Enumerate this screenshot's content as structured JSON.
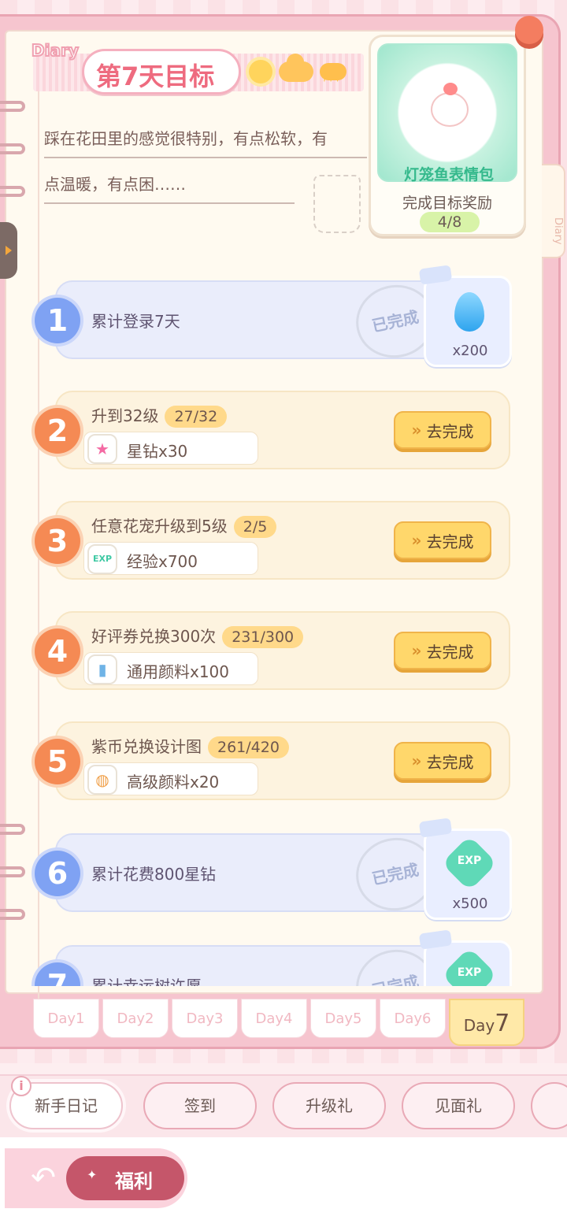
{
  "header": {
    "diary_label": "Diary",
    "title": "第7天目标",
    "story_line1": "踩在花田里的感觉很特别，有点松软，有",
    "story_line2": "点温暖，有点困……"
  },
  "reward": {
    "name": "灯笼鱼表情包",
    "caption": "完成目标奖励",
    "progress": "4/8"
  },
  "right_tab_label": "Diary",
  "tasks": [
    {
      "num": "1",
      "title": "累计登录7天",
      "state": "done",
      "stamp": "已完成",
      "reward_icon": "water-drop-icon",
      "reward_qty": "x200"
    },
    {
      "num": "2",
      "title": "升到32级",
      "progress": "27/32",
      "state": "todo",
      "item_icon": "star-diamond-icon",
      "item_name": "星钻x30",
      "button": "去完成"
    },
    {
      "num": "3",
      "title": "任意花宠升级到5级",
      "progress": "2/5",
      "state": "todo",
      "item_icon": "exp-icon",
      "item_name": "经验x700",
      "button": "去完成"
    },
    {
      "num": "4",
      "title": "好评券兑换300次",
      "progress": "231/300",
      "state": "todo",
      "item_icon": "paint-bottle-icon",
      "item_name": "通用颜料x100",
      "button": "去完成"
    },
    {
      "num": "5",
      "title": "紫币兑换设计图",
      "progress": "261/420",
      "state": "todo",
      "item_icon": "palette-icon",
      "item_name": "高级颜料x20",
      "button": "去完成"
    },
    {
      "num": "6",
      "title": "累计花费800星钻",
      "state": "done",
      "stamp": "已完成",
      "reward_icon": "exp-icon",
      "reward_qty": "x500"
    },
    {
      "num": "7",
      "title": "累计幸运树许愿",
      "state": "done",
      "stamp": "已完成",
      "reward_icon": "exp-icon"
    }
  ],
  "exp_label": "EXP",
  "day_tabs": [
    "Day1",
    "Day2",
    "Day3",
    "Day4",
    "Day5",
    "Day6"
  ],
  "active_day": {
    "prefix": "Day",
    "num": "7"
  },
  "nav_tabs": [
    "新手日记",
    "签到",
    "升级礼",
    "见面礼"
  ],
  "info": "i",
  "welfare_label": "福利",
  "colors": {
    "accent": "#ee6b7f",
    "done_blue": "#7fa2f3",
    "todo_orange": "#f58a54",
    "button_yellow": "#ffd76b"
  }
}
